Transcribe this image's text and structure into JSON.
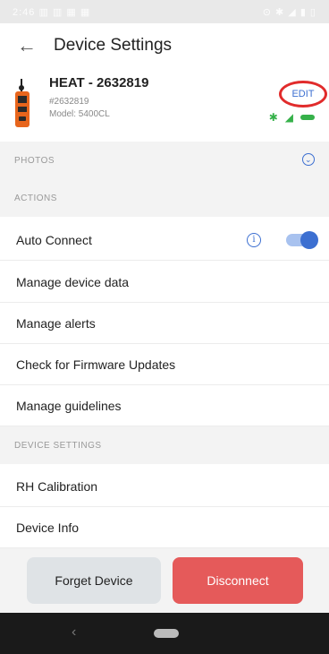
{
  "status_bar": {
    "left": "2:46 ▥ ▥ ▦ ▦",
    "right": "⊙ ✱ ◢ ▮ ▯"
  },
  "appbar": {
    "back_glyph": "←",
    "title": "Device Settings"
  },
  "device": {
    "name": "HEAT - 2632819",
    "serial": "#2632819",
    "model": "Model: 5400CL",
    "edit_label": "EDIT",
    "bluetooth_glyph": "✱",
    "wifi_glyph": "◢"
  },
  "sections": {
    "photos": "PHOTOS",
    "actions": "ACTIONS",
    "device_settings": "DEVICE SETTINGS"
  },
  "actions": {
    "auto_connect": "Auto Connect",
    "auto_connect_enabled": true,
    "manage_data": "Manage device data",
    "manage_alerts": "Manage alerts",
    "firmware": "Check for Firmware Updates",
    "guidelines": "Manage guidelines"
  },
  "settings": {
    "rh_calibration": "RH Calibration",
    "device_info": "Device Info"
  },
  "buttons": {
    "forget": "Forget Device",
    "disconnect": "Disconnect"
  },
  "icons": {
    "info": "i",
    "chevron": "⌄",
    "nav_back": "‹"
  },
  "colors": {
    "accent": "#3c6fd1",
    "danger": "#e55a5a",
    "success": "#36b14a",
    "highlight_circle": "#e12b2b"
  }
}
